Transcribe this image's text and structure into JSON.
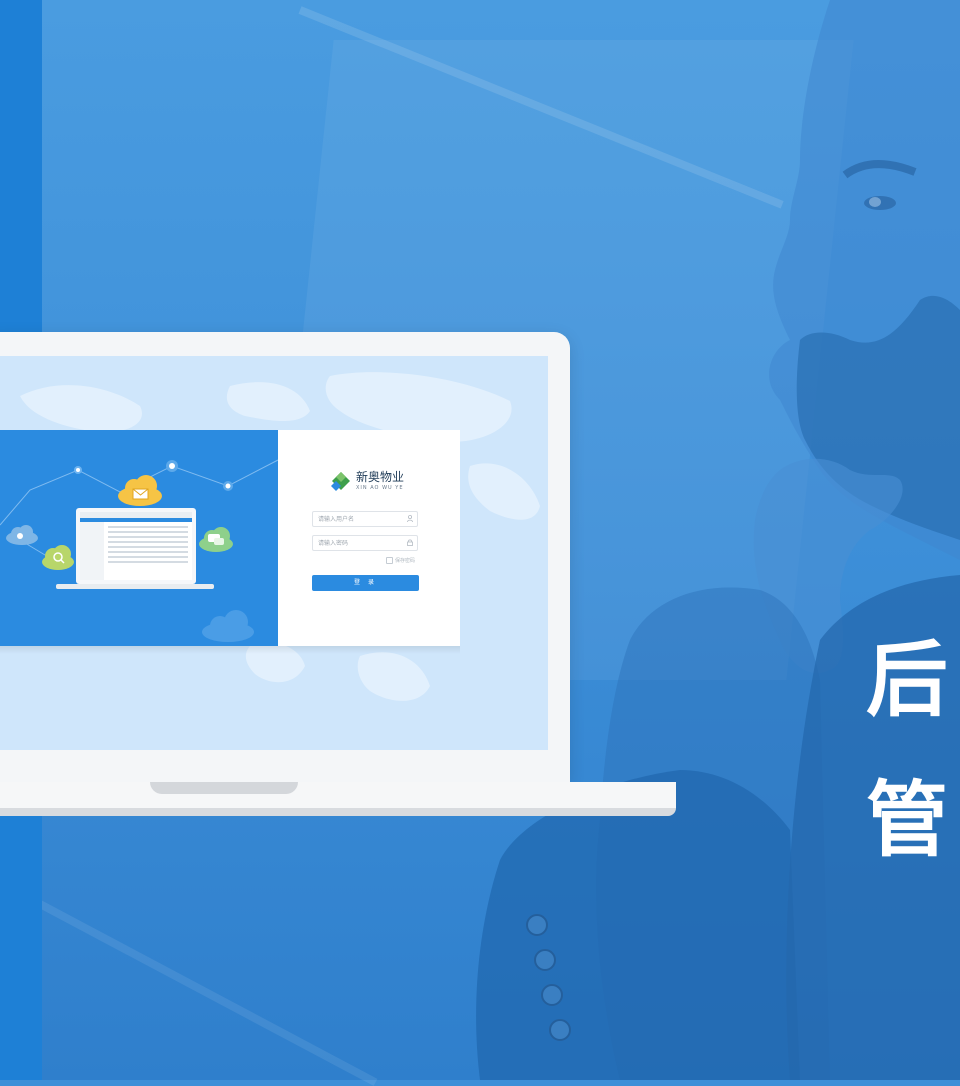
{
  "headline": {
    "line1": "后",
    "line2": "管"
  },
  "login": {
    "brand_cn": "新奥物业",
    "brand_en": "XIN AO WU YE",
    "username_placeholder": "请输入用户名",
    "password_placeholder": "请输入密码",
    "remember_label": "保存密码",
    "submit_label": "登 录"
  },
  "icons": [
    "user-icon",
    "lock-icon",
    "mail-icon",
    "search-icon",
    "chat-icon",
    "cloud-icon"
  ],
  "colors": {
    "accent": "#2b8be0",
    "background": "#3d8fd8",
    "screen_bg": "#cfe6fb",
    "left_strip": "#1e80d6"
  }
}
